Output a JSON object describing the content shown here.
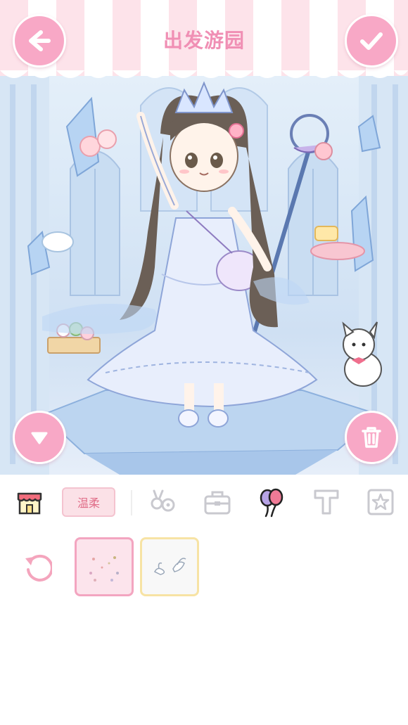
{
  "header": {
    "title": "出发游园",
    "back_icon": "arrow-left-icon",
    "confirm_icon": "checkmark-icon"
  },
  "scene": {
    "collapse_icon": "triangle-down-icon",
    "delete_icon": "trash-icon"
  },
  "toolbar": {
    "shop_icon": "shop-icon",
    "style_label": "温柔",
    "tabs": [
      {
        "icon": "flower-icon"
      },
      {
        "icon": "bag-icon"
      },
      {
        "icon": "balloon-icon"
      },
      {
        "icon": "text-icon"
      },
      {
        "icon": "star-icon"
      }
    ]
  },
  "items": {
    "reset_icon": "reset-icon",
    "cards": [
      {
        "icon": "sparkle-item",
        "selected": true
      },
      {
        "icon": "swan-item",
        "selected": false
      }
    ]
  },
  "colors": {
    "accent_pink": "#f8a8c6",
    "title_pink": "#f08fb4",
    "tag_text": "#e06d88",
    "icon_gray": "#c9c9cf"
  }
}
